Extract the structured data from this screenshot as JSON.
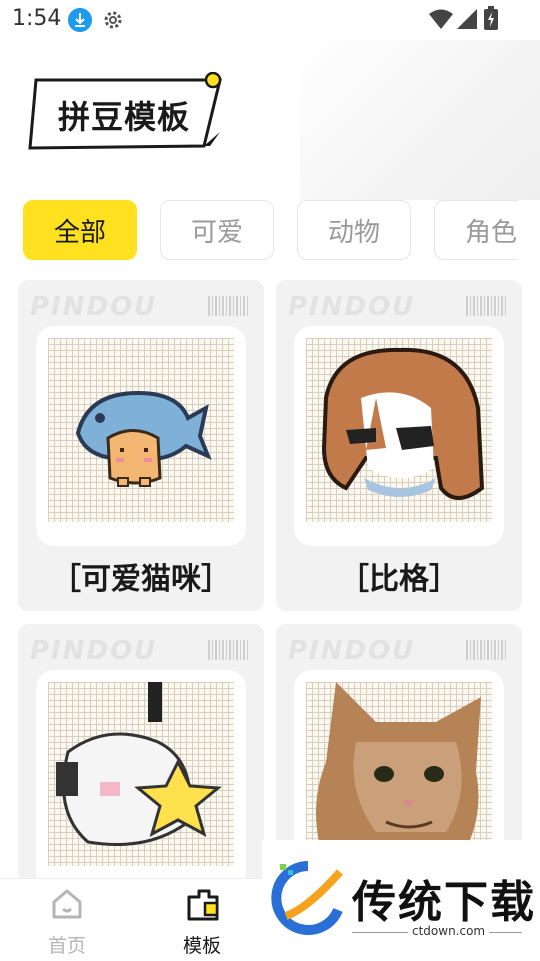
{
  "status_bar": {
    "time": "1:54"
  },
  "logo": {
    "title": "拼豆模板"
  },
  "tabs": [
    {
      "label": "全部",
      "active": true
    },
    {
      "label": "可爱",
      "active": false
    },
    {
      "label": "动物",
      "active": false
    },
    {
      "label": "角色",
      "active": false
    }
  ],
  "cards": [
    {
      "brand": "PINDOU",
      "title": "［可爱猫咪］"
    },
    {
      "brand": "PINDOU",
      "title": "［比格］"
    },
    {
      "brand": "PINDOU",
      "title": ""
    },
    {
      "brand": "PINDOU",
      "title": ""
    }
  ],
  "bottom_nav": [
    {
      "label": "首页",
      "active": false,
      "icon": "home-icon"
    },
    {
      "label": "模板",
      "active": true,
      "icon": "template-icon"
    }
  ],
  "watermark": {
    "text": "传统下载",
    "url": "ctdown.com"
  },
  "colors": {
    "accent": "#ffe11f",
    "download": "#1e9bf0",
    "card_bg": "#f2f2f2"
  }
}
